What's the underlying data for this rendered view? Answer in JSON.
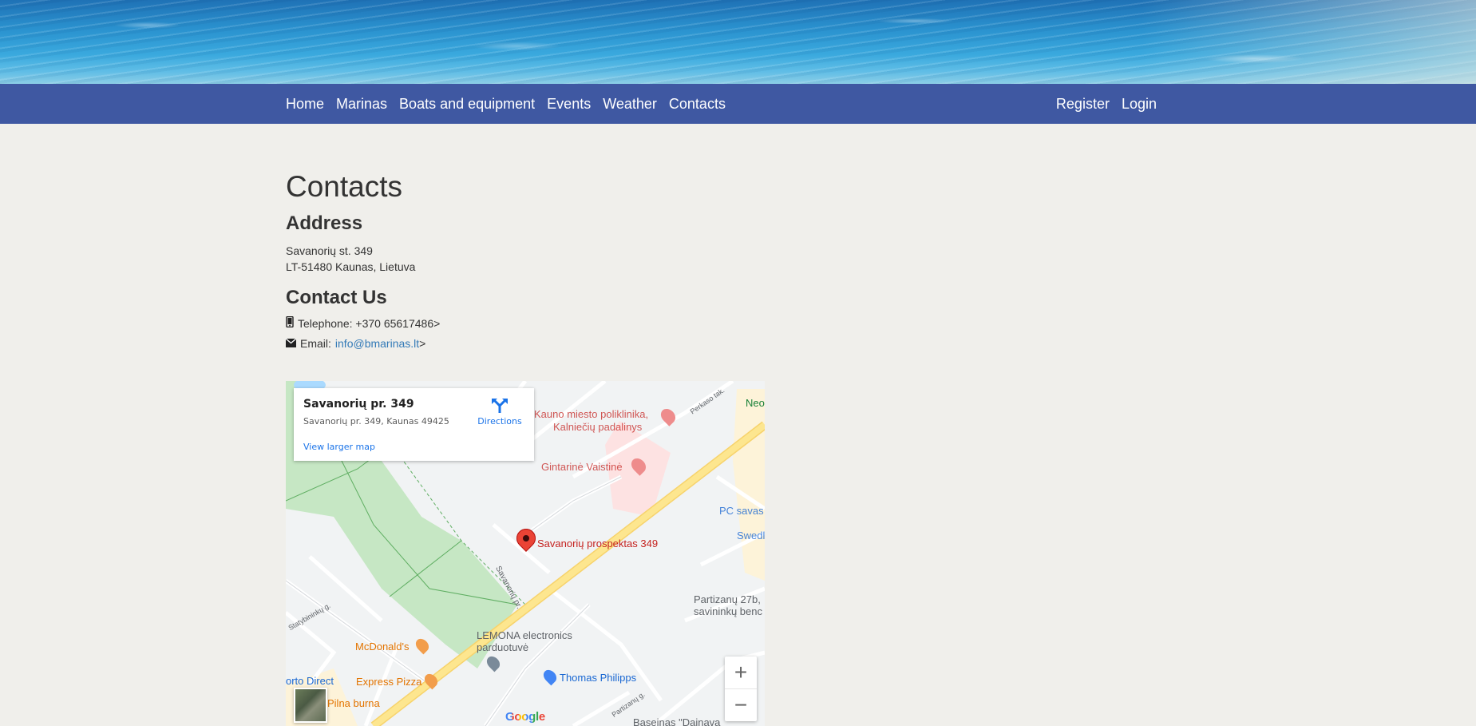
{
  "nav": {
    "left": [
      "Home",
      "Marinas",
      "Boats and equipment",
      "Events",
      "Weather",
      "Contacts"
    ],
    "right": [
      "Register",
      "Login"
    ]
  },
  "page": {
    "title": "Contacts",
    "address_heading": "Address",
    "address_lines": [
      "Savanorių st. 349",
      "LT-51480 Kaunas, Lietuva"
    ],
    "contact_heading": "Contact Us",
    "telephone_label": "Telephone: +370 65617486>",
    "email_label": "Email:",
    "email_link": "info@bmarinas.lt",
    "email_suffix": ">"
  },
  "map": {
    "info_title": "Savanorių pr. 349",
    "info_address": "Savanorių pr. 349, Kaunas 49425",
    "directions_label": "Directions",
    "larger_map_label": "View larger map",
    "marker_label": "Savanorių prospektas 349",
    "pois": {
      "clinic": "Kauno miesto poliklinika,",
      "clinic2": "Kalniečių padalinys",
      "pharmacy": "Gintarinė Vaistinė",
      "neo": "Neo",
      "pc": "PC savas",
      "swed": "Swedl",
      "partizanu": "Partizanų 27b,",
      "partizanu2": "savininkų benc",
      "lemona": "LEMONA electronics",
      "lemona2": "parduotuvė",
      "thomas": "Thomas Philipps",
      "mcd": "McDonald's",
      "express": "Express Pizza",
      "pilna": "Pilna burna",
      "porto": "orto Direct",
      "baseinas": "Baseinas \"Dainava",
      "street_savanoriu": "Savanorių pr.",
      "street_perkaso": "Perkaso tak.",
      "street_statybininku": "Statybininkų g.",
      "street_partizanu": "Partizanų g."
    },
    "zoom_in": "+",
    "zoom_out": "−",
    "google": "Google",
    "colors": {
      "park": "#c6e7c4",
      "road_major": "#fde68f",
      "hospital_zone": "#fde2e2",
      "marker": "#ea4335"
    }
  }
}
